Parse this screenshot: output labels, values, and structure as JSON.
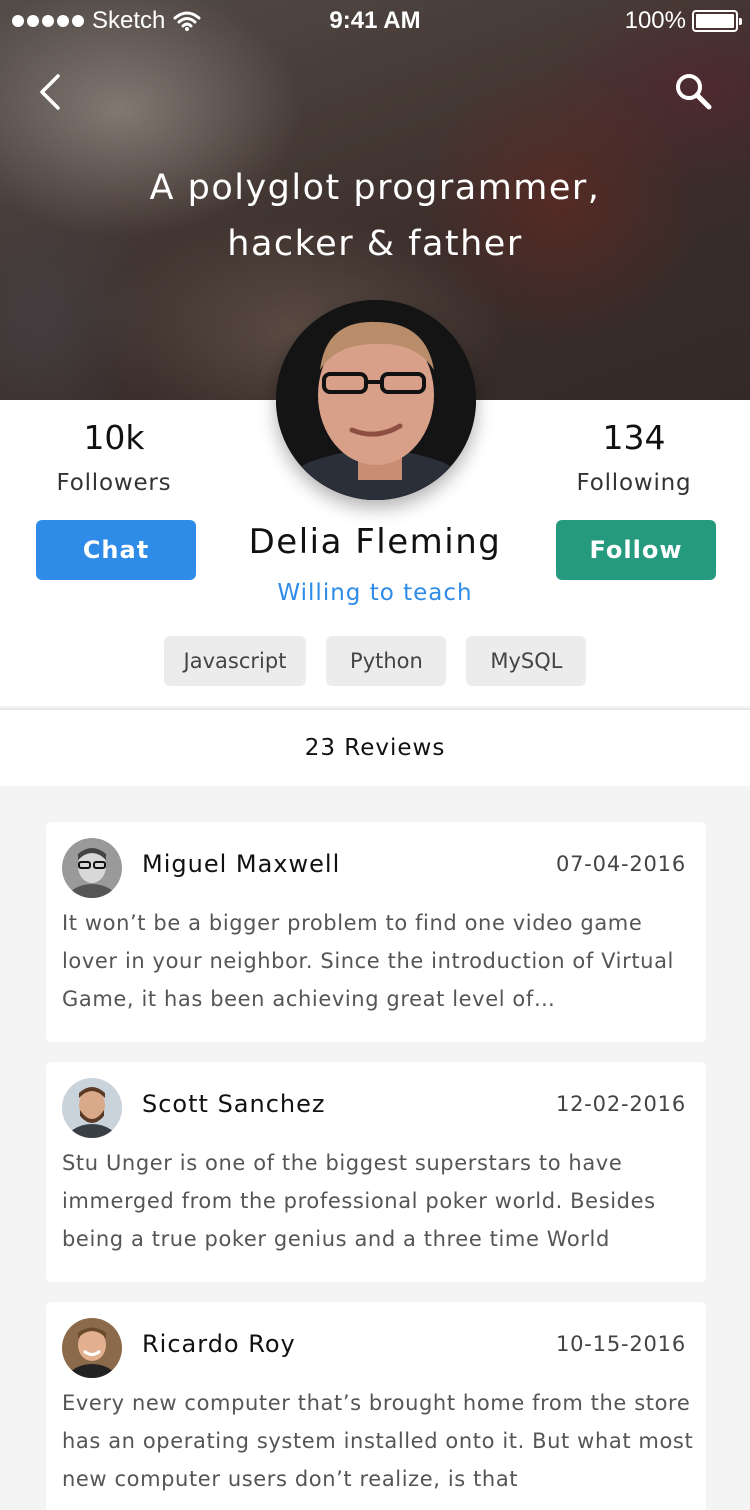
{
  "status_bar": {
    "carrier": "Sketch",
    "time": "9:41 AM",
    "battery": "100%",
    "battery_level": 1.0
  },
  "header": {
    "tagline_line1": "A polyglot programmer,",
    "tagline_line2": "hacker & father"
  },
  "profile": {
    "followers_count": "10k",
    "followers_label": "Followers",
    "following_count": "134",
    "following_label": "Following",
    "name": "Delia Fleming",
    "subtitle": "Willing to teach",
    "chat_label": "Chat",
    "follow_label": "Follow",
    "tags": [
      "Javascript",
      "Python",
      "MySQL"
    ]
  },
  "reviews": {
    "header": "23 Reviews",
    "items": [
      {
        "name": "Miguel Maxwell",
        "date": "07-04-2016",
        "text": "It won’t be a bigger problem to find one video game lover in your neighbor. Since the introduction of Virtual Game, it has been achieving great level of…"
      },
      {
        "name": "Scott Sanchez",
        "date": "12-02-2016",
        "text": "Stu Unger is one of the biggest superstars to have immerged from the professional poker world. Besides being a true poker genius and a three time World"
      },
      {
        "name": "Ricardo Roy",
        "date": "10-15-2016",
        "text": "Every new computer that’s brought home from the store has an operating system installed onto it. But what most new computer users don’t realize, is that"
      }
    ]
  },
  "colors": {
    "chat_button": "#2e8be8",
    "follow_button": "#259a7e",
    "subtitle": "#2e8be8"
  },
  "icons": {
    "back": "chevron-left-icon",
    "search": "search-icon",
    "wifi": "wifi-icon",
    "battery": "battery-icon"
  }
}
